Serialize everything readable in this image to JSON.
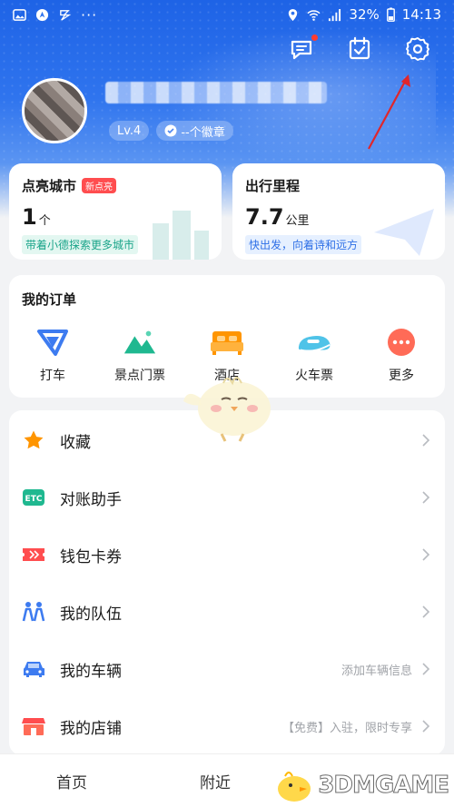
{
  "status_bar": {
    "battery": "32%",
    "time": "14:13"
  },
  "profile": {
    "level": "Lv.4",
    "badge": "--个徽章"
  },
  "stats": {
    "cities": {
      "title": "点亮城市",
      "tag": "新点亮",
      "value": "1",
      "unit": "个",
      "tip": "带着小德探索更多城市"
    },
    "mileage": {
      "title": "出行里程",
      "value": "7.7",
      "unit": "公里",
      "tip": "快出发，向着诗和远方"
    }
  },
  "orders": {
    "title": "我的订单",
    "items": [
      {
        "label": "打车",
        "icon": "taxi-icon"
      },
      {
        "label": "景点门票",
        "icon": "scenic-ticket-icon"
      },
      {
        "label": "酒店",
        "icon": "hotel-icon"
      },
      {
        "label": "火车票",
        "icon": "train-ticket-icon"
      },
      {
        "label": "更多",
        "icon": "more-icon"
      }
    ]
  },
  "menu": [
    {
      "label": "收藏",
      "hint": "",
      "icon": "star-icon"
    },
    {
      "label": "对账助手",
      "hint": "",
      "icon": "etc-icon"
    },
    {
      "label": "钱包卡券",
      "hint": "",
      "icon": "coupon-icon"
    },
    {
      "label": "我的队伍",
      "hint": "",
      "icon": "team-icon"
    },
    {
      "label": "我的车辆",
      "hint": "添加车辆信息",
      "icon": "car-icon"
    },
    {
      "label": "我的店铺",
      "hint": "【免费】入驻，限时专享",
      "icon": "shop-icon"
    }
  ],
  "bottom_nav": [
    {
      "label": "首页"
    },
    {
      "label": "附近"
    }
  ],
  "watermark": "3DMGAME",
  "colors": {
    "header_blue": "#1e63e6",
    "accent_orange": "#ff9500",
    "tag_red": "#ff4d4f"
  }
}
